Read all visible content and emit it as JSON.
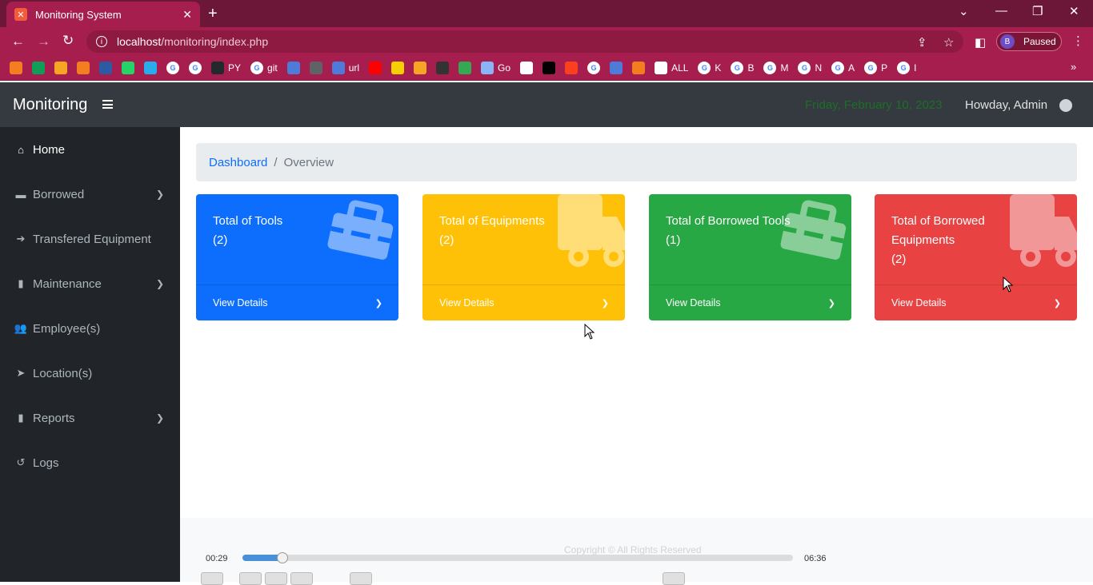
{
  "browser": {
    "tab_title": "Monitoring System",
    "url_host": "localhost",
    "url_path": "/monitoring/index.php",
    "profile_initial": "B",
    "profile_status": "Paused",
    "bookmarks": [
      {
        "icon": "generic-icon",
        "label": "",
        "color": "#f47d20"
      },
      {
        "icon": "green-plus-icon",
        "label": "",
        "color": "#0f9d58"
      },
      {
        "icon": "orange-icon",
        "label": "",
        "color": "#f6a623"
      },
      {
        "icon": "chart-icon",
        "label": "",
        "color": "#f47d20"
      },
      {
        "icon": "ieee-icon",
        "label": "",
        "color": "#2d5ba3"
      },
      {
        "icon": "whatsapp-icon",
        "label": "",
        "color": "#25d366"
      },
      {
        "icon": "telegram-icon",
        "label": "",
        "color": "#2aabee"
      },
      {
        "icon": "google-icon",
        "label": "",
        "color": "#ffffff"
      },
      {
        "icon": "google-icon",
        "label": "",
        "color": "#ffffff"
      },
      {
        "icon": "github-icon",
        "label": "PY",
        "color": "#24292e"
      },
      {
        "icon": "google-icon",
        "label": "git",
        "color": "#ffffff"
      },
      {
        "icon": "blue-icon",
        "label": "",
        "color": "#4c7bd9"
      },
      {
        "icon": "store-icon",
        "label": "",
        "color": "#5f6368"
      },
      {
        "icon": "cloud-icon",
        "label": "url",
        "color": "#4c7bd9"
      },
      {
        "icon": "youtube-icon",
        "label": "",
        "color": "#ff0000"
      },
      {
        "icon": "p-icon",
        "label": "",
        "color": "#f5d000"
      },
      {
        "icon": "folder-icon",
        "label": "",
        "color": "#f6a623"
      },
      {
        "icon": "dark-icon",
        "label": "",
        "color": "#333333"
      },
      {
        "icon": "ring-icon",
        "label": "",
        "color": "#34a853"
      },
      {
        "icon": "loop-icon",
        "label": "Go",
        "color": "#8ab4f8"
      },
      {
        "icon": "puzzle-icon",
        "label": "",
        "color": "#ffffff"
      },
      {
        "icon": "ci-icon",
        "label": "",
        "color": "#000000"
      },
      {
        "icon": "yandex-icon",
        "label": "",
        "color": "#fc3f1d"
      },
      {
        "icon": "google-icon",
        "label": "",
        "color": "#ffffff"
      },
      {
        "icon": "flag-icon",
        "label": "",
        "color": "#4c7bd9"
      },
      {
        "icon": "tiger-icon",
        "label": "",
        "color": "#f47d20"
      },
      {
        "icon": "globe-icon",
        "label": "ALL",
        "color": "#ffffff"
      },
      {
        "icon": "google-icon",
        "label": "K",
        "color": "#ffffff"
      },
      {
        "icon": "google-icon",
        "label": "B",
        "color": "#ffffff"
      },
      {
        "icon": "google-icon",
        "label": "M",
        "color": "#ffffff"
      },
      {
        "icon": "google-icon",
        "label": "N",
        "color": "#ffffff"
      },
      {
        "icon": "google-icon",
        "label": "A",
        "color": "#ffffff"
      },
      {
        "icon": "google-icon",
        "label": "P",
        "color": "#ffffff"
      },
      {
        "icon": "google-icon",
        "label": "I",
        "color": "#ffffff"
      }
    ]
  },
  "header": {
    "brand": "Monitoring",
    "date": "Friday, February 10, 2023",
    "greeting": "Howday, Admin"
  },
  "sidebar": {
    "items": [
      {
        "label": "Home",
        "icon": "home-icon",
        "has_chevron": false,
        "active": true
      },
      {
        "label": "Borrowed",
        "icon": "folder-icon",
        "has_chevron": true,
        "active": false
      },
      {
        "label": "Transfered Equipment",
        "icon": "arrow-right-icon",
        "has_chevron": false,
        "active": false
      },
      {
        "label": "Maintenance",
        "icon": "book-icon",
        "has_chevron": true,
        "active": false
      },
      {
        "label": "Employee(s)",
        "icon": "users-icon",
        "has_chevron": false,
        "active": false
      },
      {
        "label": "Location(s)",
        "icon": "location-arrow-icon",
        "has_chevron": false,
        "active": false
      },
      {
        "label": "Reports",
        "icon": "book-icon",
        "has_chevron": true,
        "active": false
      },
      {
        "label": "Logs",
        "icon": "history-icon",
        "has_chevron": false,
        "active": false
      }
    ]
  },
  "breadcrumb": {
    "link": "Dashboard",
    "current": "Overview"
  },
  "cards": [
    {
      "title": "Total of Tools",
      "count": "(2)",
      "footer": "View Details",
      "color": "#0d6efd",
      "icon": "toolbox-icon"
    },
    {
      "title": "Total of Equipments",
      "count": "(2)",
      "footer": "View Details",
      "color": "#ffc107",
      "icon": "truck-icon"
    },
    {
      "title": "Total of Borrowed Tools",
      "count": "(1)",
      "footer": "View Details",
      "color": "#28a745",
      "icon": "toolbox-icon"
    },
    {
      "title": "Total of Borrowed Equipments",
      "count": "(2)",
      "footer": "View Details",
      "color": "#e84242",
      "icon": "truck-icon"
    }
  ],
  "footer": {
    "copyright": "Copyright © All Rights Reserved"
  },
  "player": {
    "elapsed": "00:29",
    "total": "06:36",
    "progress": 0.073
  }
}
